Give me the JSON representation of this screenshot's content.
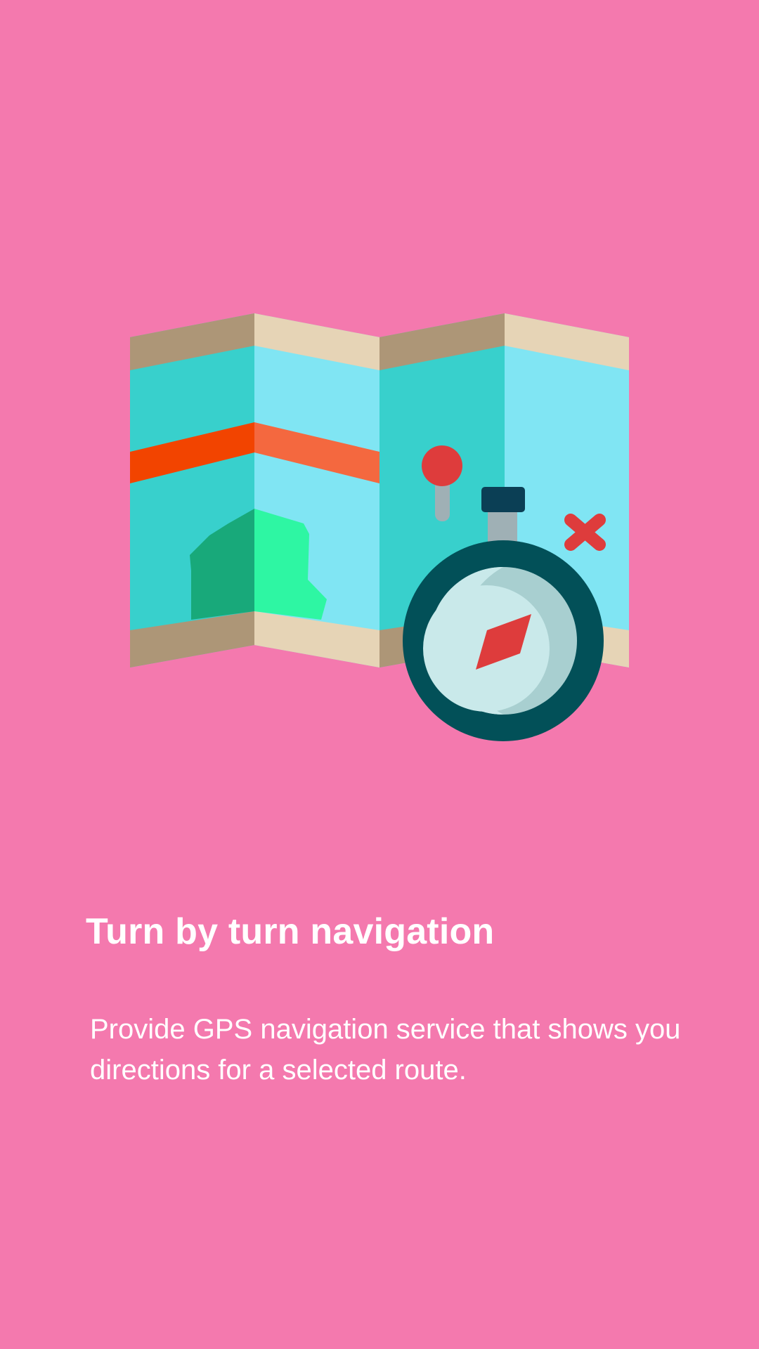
{
  "onboarding": {
    "illustration_icon": "folded-map-with-compass-icon",
    "title": "Turn by turn navigation",
    "description": "Provide GPS navigation service that shows you directions for a selected route."
  },
  "colors": {
    "background": "#F479AE",
    "text": "#FFFFFF",
    "map_teal": "#38D0CC",
    "map_light_blue": "#80E5F3",
    "map_border_dark": "#AD9677",
    "map_border_light": "#E6D4B6",
    "route_dark": "#F24400",
    "route_light": "#F4683F",
    "park_dark": "#18A97A",
    "park_light": "#2EF6A3",
    "marker_red": "#DE3C3C",
    "compass_ring": "#025058",
    "compass_face": "#C9E9EA",
    "compass_needle": "#DE3C3C"
  }
}
